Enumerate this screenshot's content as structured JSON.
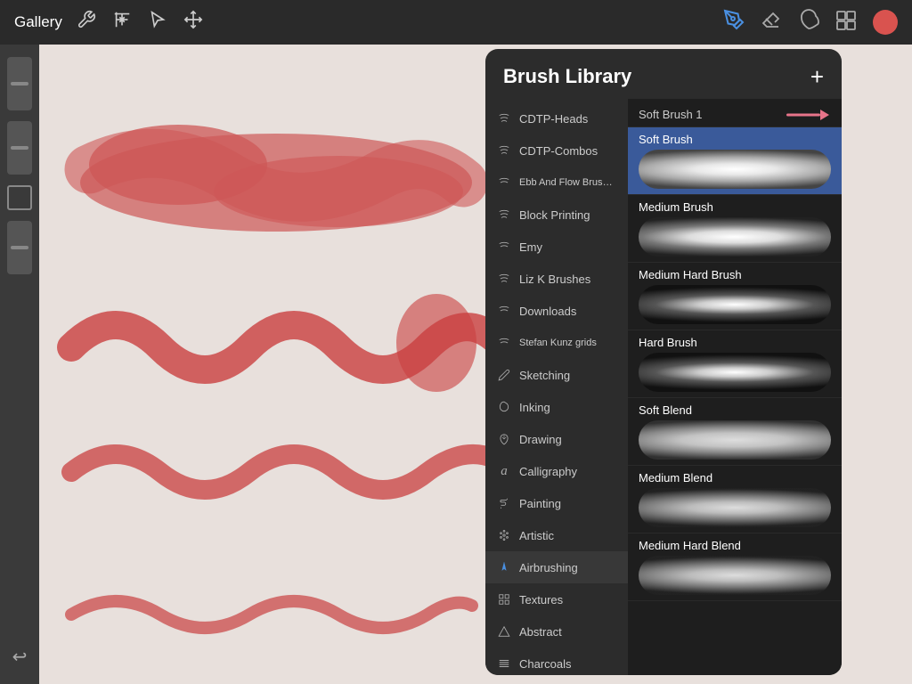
{
  "toolbar": {
    "gallery_label": "Gallery",
    "add_label": "+",
    "tools": [
      {
        "name": "wrench",
        "symbol": "🔧"
      },
      {
        "name": "magic",
        "symbol": "✦"
      },
      {
        "name": "selection",
        "symbol": "S"
      },
      {
        "name": "transform",
        "symbol": "⬡"
      }
    ],
    "right_tools": [
      {
        "name": "pen",
        "symbol": "✏"
      },
      {
        "name": "eraser",
        "symbol": "◻"
      },
      {
        "name": "smudge",
        "symbol": "◈"
      },
      {
        "name": "layers",
        "symbol": "⊞"
      }
    ]
  },
  "brush_library": {
    "title": "Brush Library",
    "add_label": "+",
    "categories": [
      {
        "id": "cdtp-heads",
        "label": "CDTP-Heads",
        "icon": "~"
      },
      {
        "id": "cdtp-combos",
        "label": "CDTP-Combos",
        "icon": "~"
      },
      {
        "id": "ebb-flow",
        "label": "Ebb And Flow Brushes",
        "icon": "~"
      },
      {
        "id": "block-printing",
        "label": "Block Printing",
        "icon": "~"
      },
      {
        "id": "emy",
        "label": "Emy",
        "icon": "~"
      },
      {
        "id": "liz-k",
        "label": "Liz K Brushes",
        "icon": "~"
      },
      {
        "id": "downloads",
        "label": "Downloads",
        "icon": "~"
      },
      {
        "id": "stefan-kunz",
        "label": "Stefan Kunz grids",
        "icon": "~"
      },
      {
        "id": "sketching",
        "label": "Sketching",
        "icon": "pencil"
      },
      {
        "id": "inking",
        "label": "Inking",
        "icon": "drop"
      },
      {
        "id": "drawing",
        "label": "Drawing",
        "icon": "spiral"
      },
      {
        "id": "calligraphy",
        "label": "Calligraphy",
        "icon": "a"
      },
      {
        "id": "painting",
        "label": "Painting",
        "icon": "brush"
      },
      {
        "id": "artistic",
        "label": "Artistic",
        "icon": "palette"
      },
      {
        "id": "airbrushing",
        "label": "Airbrushing",
        "icon": "airbrush",
        "active": true
      },
      {
        "id": "textures",
        "label": "Textures",
        "icon": "grid"
      },
      {
        "id": "abstract",
        "label": "Abstract",
        "icon": "triangle"
      },
      {
        "id": "charcoals",
        "label": "Charcoals",
        "icon": "bars"
      }
    ],
    "brushes": [
      {
        "id": "soft-brush-1",
        "name": "Soft Brush 1",
        "is_header": true
      },
      {
        "id": "soft-brush",
        "name": "Soft Brush",
        "selected": true,
        "preview": "soft"
      },
      {
        "id": "medium-brush",
        "name": "Medium Brush",
        "selected": false,
        "preview": "medium"
      },
      {
        "id": "medium-hard-brush",
        "name": "Medium Hard Brush",
        "selected": false,
        "preview": "hard"
      },
      {
        "id": "hard-brush",
        "name": "Hard Brush",
        "selected": false,
        "preview": "hard"
      },
      {
        "id": "soft-blend",
        "name": "Soft Blend",
        "selected": false,
        "preview": "blend-soft"
      },
      {
        "id": "medium-blend",
        "name": "Medium Blend",
        "selected": false,
        "preview": "blend-medium"
      },
      {
        "id": "medium-hard-blend",
        "name": "Medium Hard Blend",
        "selected": false,
        "preview": "blend-medium"
      }
    ]
  }
}
